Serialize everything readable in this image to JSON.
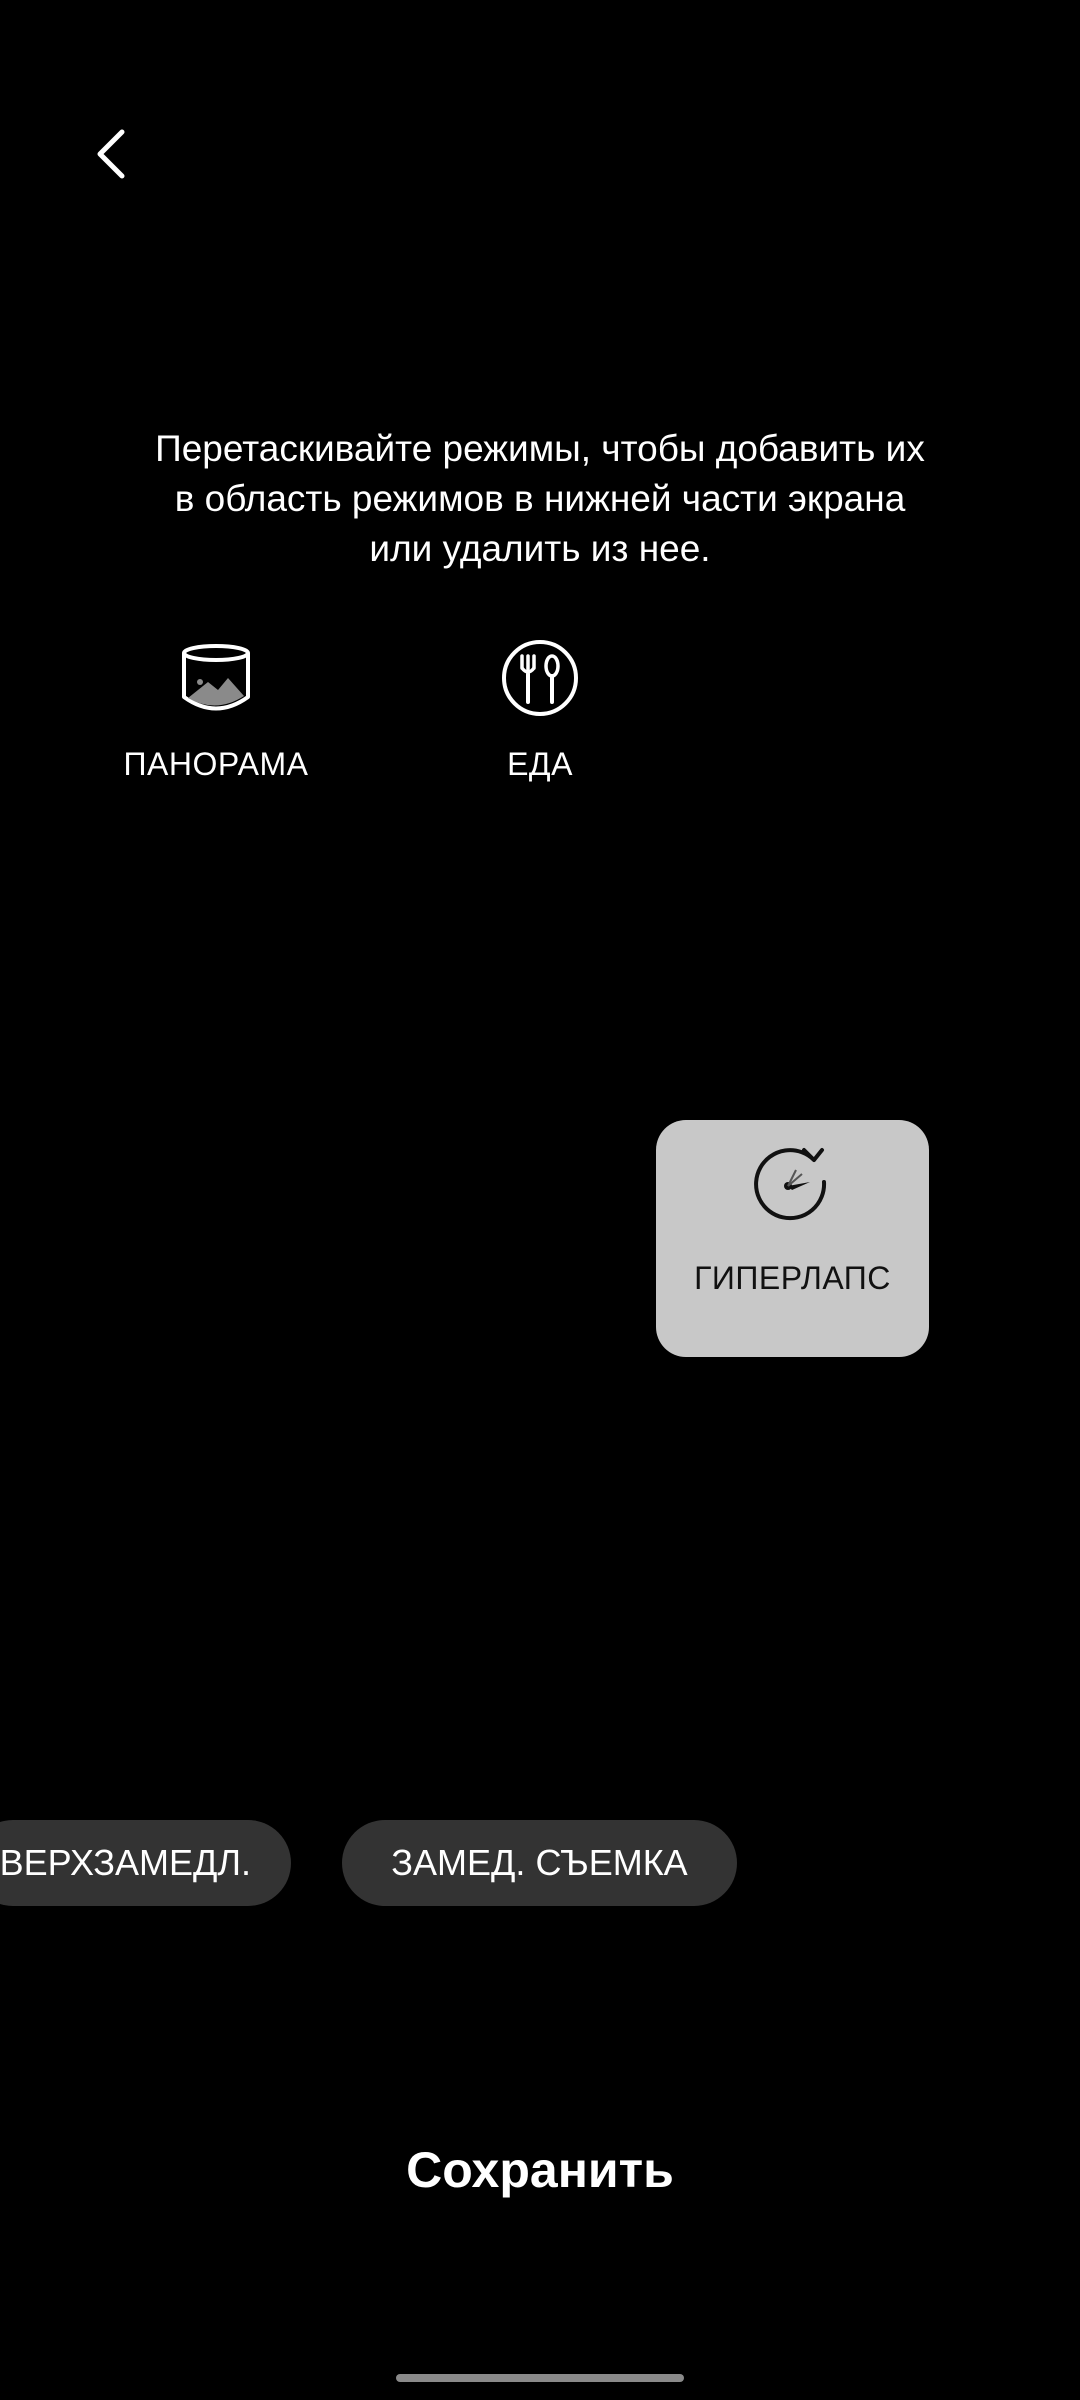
{
  "header": {
    "back_icon": "chevron-left-icon"
  },
  "instruction": {
    "line1": "Перетаскивайте режимы, чтобы добавить их",
    "line2": "в область режимов в нижней части экрана",
    "line3": "или удалить из нее."
  },
  "available_modes": [
    {
      "label": "ПАНОРАМА",
      "icon": "panorama-icon"
    },
    {
      "label": "ЕДА",
      "icon": "food-icon"
    }
  ],
  "dragging_mode": {
    "label": "ГИПЕРЛАПС",
    "icon": "hyperlapse-icon"
  },
  "mode_bar": [
    {
      "label": "ВЕРХЗАМЕДЛ."
    },
    {
      "label": "ЗАМЕД. СЪЕМКА"
    }
  ],
  "footer": {
    "save_label": "Сохранить"
  },
  "colors": {
    "background": "#000000",
    "tile": "#c8c8c8",
    "chip": "#333333",
    "text": "#ffffff"
  }
}
